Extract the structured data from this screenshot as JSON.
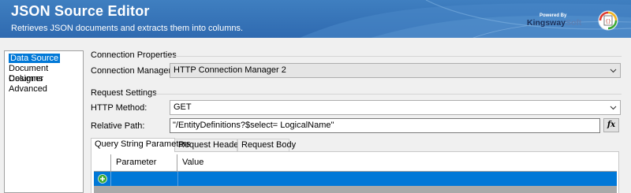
{
  "header": {
    "title": "JSON Source Editor",
    "subtitle": "Retrieves JSON documents and extracts them into columns.",
    "brand_powered": "Powered By",
    "brand_name_1": "Kingsway",
    "brand_name_2": "Soft"
  },
  "sidebar": {
    "items": [
      {
        "label": "Data Source",
        "selected": true
      },
      {
        "label": "Document Designer"
      },
      {
        "label": "Columns"
      },
      {
        "label": "Advanced"
      }
    ]
  },
  "connection": {
    "group_title": "Connection Properties",
    "manager_label": "Connection Manager:",
    "manager_value": "HTTP Connection Manager 2"
  },
  "request": {
    "group_title": "Request Settings",
    "method_label": "HTTP Method:",
    "method_value": "GET",
    "path_label": "Relative Path:",
    "path_value": "\"/EntityDefinitions?$select= LogicalName\"",
    "fx_label": "fx"
  },
  "tabs": [
    {
      "label": "Query String Parameters",
      "active": true
    },
    {
      "label": "Request Headers"
    },
    {
      "label": "Request Body"
    }
  ],
  "grid": {
    "columns": [
      "Parameter Name",
      "Value"
    ],
    "rows": []
  },
  "colors": {
    "header_blue": "#3a78bc",
    "selection_blue": "#0078d7",
    "add_green": "#3aa832"
  }
}
